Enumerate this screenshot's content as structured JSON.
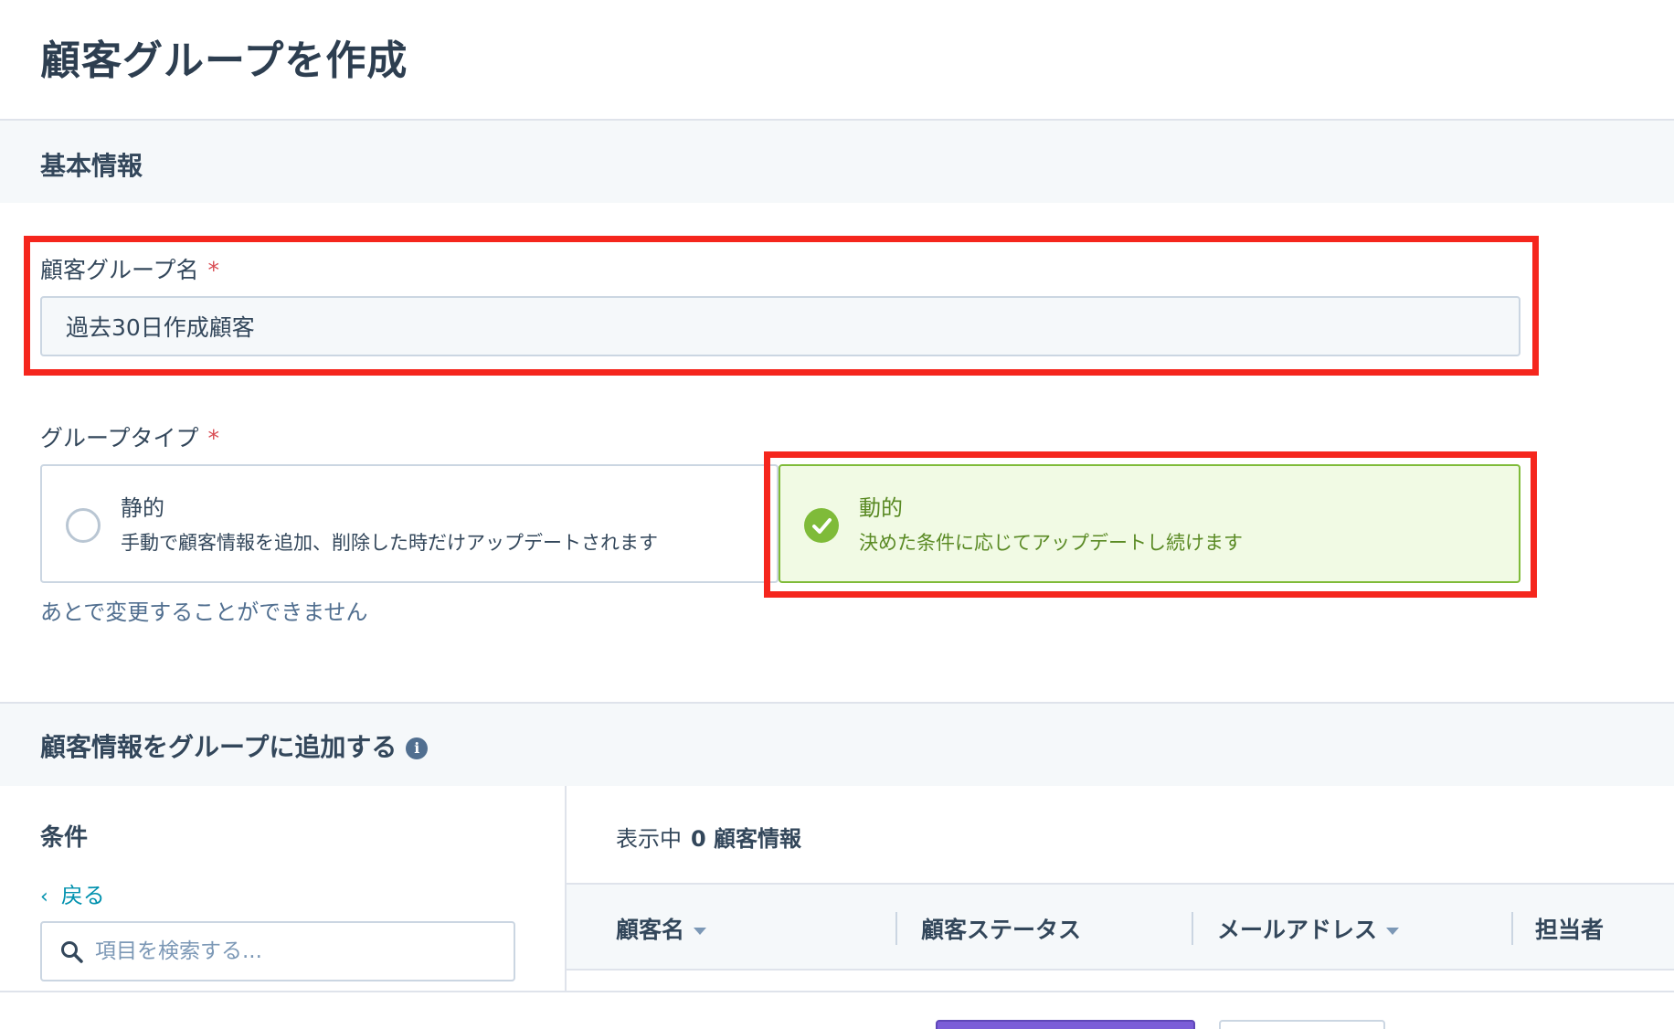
{
  "page": {
    "title": "顧客グループを作成"
  },
  "basic_info": {
    "section_title": "基本情報",
    "group_name_label": "顧客グループ名",
    "required_mark": "*",
    "group_name_value": "過去30日作成顧客",
    "group_type_label": "グループタイプ",
    "options": [
      {
        "title": "静的",
        "description": "手動で顧客情報を追加、削除した時だけアップデートされます",
        "selected": false
      },
      {
        "title": "動的",
        "description": "決めた条件に応じてアップデートし続けます",
        "selected": true
      }
    ],
    "help_text": "あとで変更することができません"
  },
  "add_section": {
    "title": "顧客情報をグループに追加する",
    "info_icon": "info-icon",
    "conditions_title": "条件",
    "back_link": "戻る",
    "search_placeholder": "項目を検索する...",
    "showing_prefix": "表示中",
    "showing_count": "0 顧客情報",
    "columns": [
      "顧客名",
      "顧客ステータス",
      "メールアドレス",
      "担当者"
    ]
  },
  "colors": {
    "accent_selected": "#7fbb39",
    "highlight_box": "#f5261d",
    "primary_button": "#7b5dd8",
    "link": "#0091ae"
  }
}
